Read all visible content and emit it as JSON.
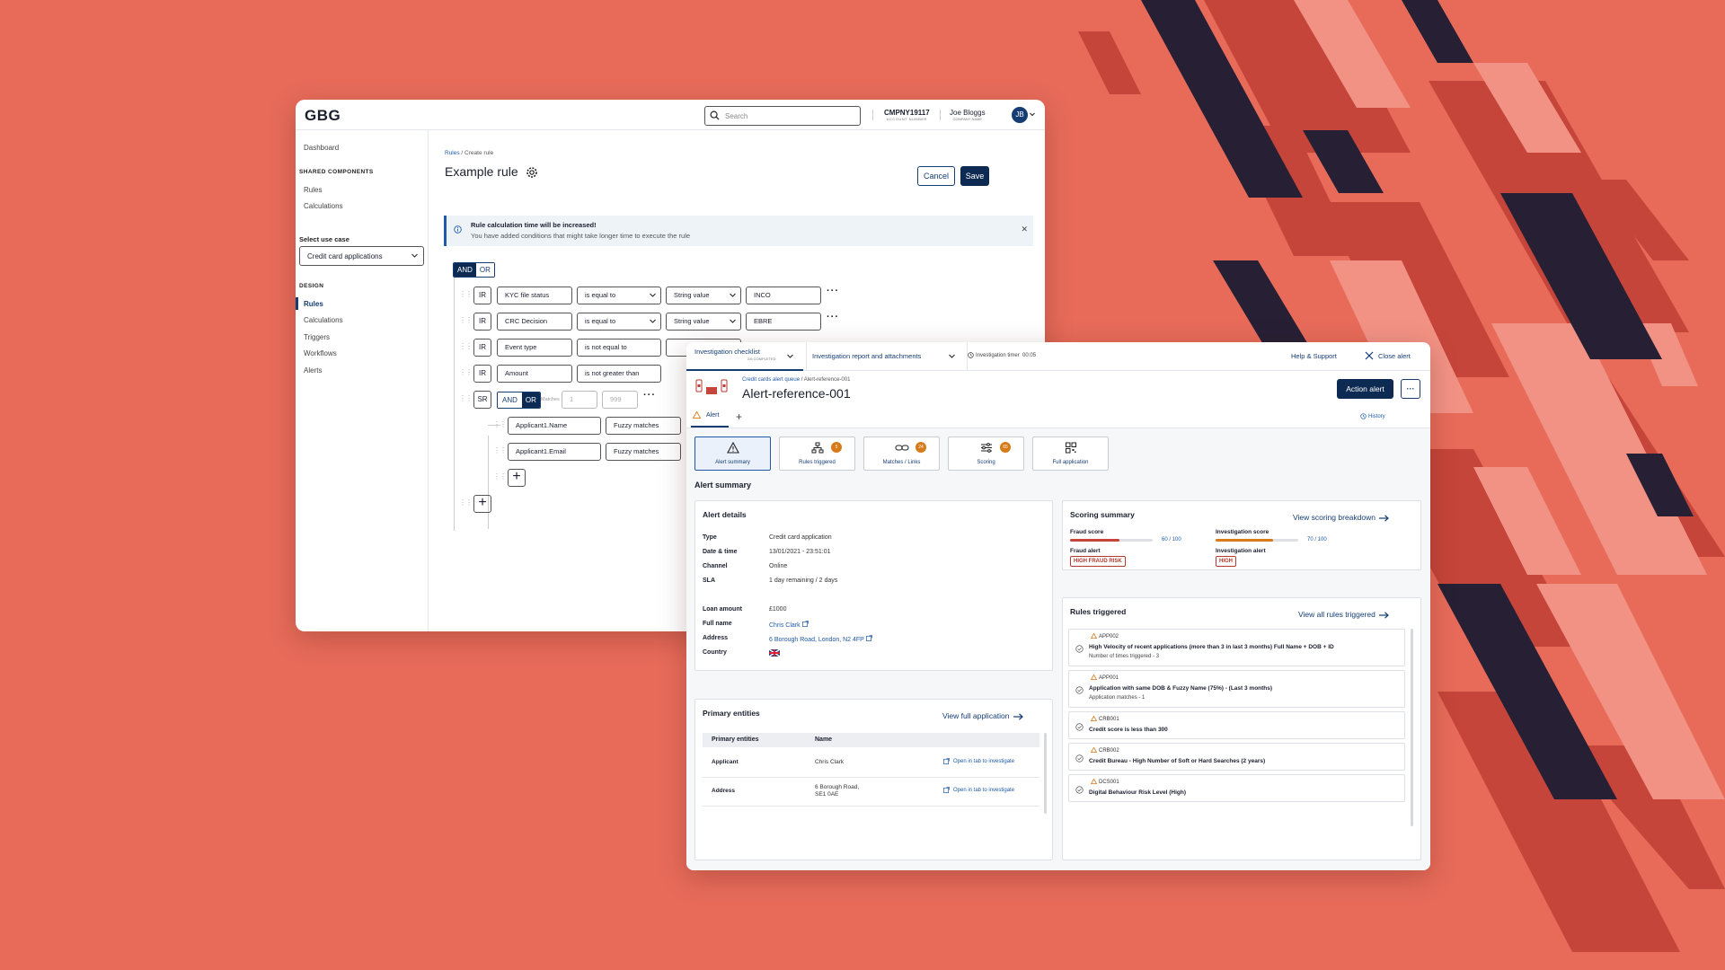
{
  "colors": {
    "background": "#E86B5A",
    "navy": "#0d2b52",
    "dark_stripe": "#272035",
    "accent_orange": "#d77a18",
    "danger": "#b33a2c"
  },
  "rules_window": {
    "logo": "GBG",
    "search_placeholder": "Search",
    "account": {
      "id": "CMPNY19117",
      "label": "ACCOUNT NUMBER"
    },
    "user": {
      "name": "Joe Bloggs",
      "label": "COMPANY NAME",
      "initials": "JB"
    },
    "sidebar": {
      "dashboard": "Dashboard",
      "shared_heading": "SHARED COMPONENTS",
      "shared_items": [
        "Rules",
        "Calculations"
      ],
      "use_case_label": "Select use case",
      "use_case_value": "Credit card applications",
      "design_heading": "DESIGN",
      "design_items": [
        "Rules",
        "Calculations",
        "Triggers",
        "Workflows",
        "Alerts"
      ],
      "active": "Rules"
    },
    "breadcrumb": {
      "parent": "Rules",
      "current": "Create rule"
    },
    "title": "Example rule",
    "cancel_label": "Cancel",
    "save_label": "Save",
    "banner": {
      "title": "Rule calculation time will be increased!",
      "text": "You have added conditions that might take longer time to execute the rule"
    },
    "logic": {
      "and": "AND",
      "or": "OR",
      "active": "AND"
    },
    "conditions": [
      {
        "tag": "IR",
        "field": "KYC file status",
        "operator": "is equal to",
        "type": "String value",
        "value": "INCO"
      },
      {
        "tag": "IR",
        "field": "CRC Decision",
        "operator": "is equal to",
        "type": "String value",
        "value": "EBRE"
      },
      {
        "tag": "IR",
        "field": "Event type",
        "operator": "is not equal to"
      },
      {
        "tag": "IR",
        "field": "Amount",
        "operator": "is not greater than"
      }
    ],
    "subrule": {
      "tag": "SR",
      "and": "AND",
      "or": "OR",
      "active": "OR",
      "matches_label": "Matches",
      "min_placeholder": "1",
      "max_placeholder": "999",
      "items": [
        {
          "field": "Applicant1.Name",
          "operator": "Fuzzy matches"
        },
        {
          "field": "Applicant1.Email",
          "operator": "Fuzzy matches"
        }
      ]
    }
  },
  "alert_window": {
    "tabs": {
      "checklist": "Investigation checklist",
      "checklist_progress": "2/6 COMPLETED",
      "report": "Investigation report and attachments"
    },
    "timer": {
      "label": "Investigation timer",
      "value": "00:05"
    },
    "help": "Help & Support",
    "close": "Close alert",
    "breadcrumb": {
      "parent": "Credit cards alert queue",
      "current": "Alert-reference-001"
    },
    "title": "Alert-reference-001",
    "action_label": "Action alert",
    "alert_tab": "Alert",
    "history": "History",
    "cards": [
      {
        "label": "Alert summary",
        "icon": "warning-icon",
        "badge": ""
      },
      {
        "label": "Rules triggered",
        "icon": "hierarchy-icon",
        "badge": "5"
      },
      {
        "label": "Matches / Links",
        "icon": "link-icon",
        "badge": "24"
      },
      {
        "label": "Scoring",
        "icon": "sliders-icon",
        "badge": "65"
      },
      {
        "label": "Full application",
        "icon": "qr-grid-icon",
        "badge": ""
      }
    ],
    "section_title": "Alert summary",
    "alert_details": {
      "title": "Alert details",
      "rows": [
        {
          "k": "Type",
          "v": "Credit card application"
        },
        {
          "k": "Date & time",
          "v": "13/01/2021 - 23:51:01"
        },
        {
          "k": "Channel",
          "v": "Online"
        },
        {
          "k": "SLA",
          "v": "1 day remaining / 2 days"
        }
      ],
      "rows2": [
        {
          "k": "Loan amount",
          "v": "£1000"
        },
        {
          "k": "Full name",
          "v": "Chris Clark"
        },
        {
          "k": "Address",
          "v": "6 Borough Road, London, N2 4FP"
        },
        {
          "k": "Country",
          "v": ""
        }
      ]
    },
    "primary": {
      "title": "Primary entities",
      "link": "View full application",
      "headers": [
        "Primary entities",
        "Name"
      ],
      "rows": [
        {
          "entity": "Applicant",
          "name": "Chris Clark",
          "name2": "",
          "action": "Open in tab to investigate"
        },
        {
          "entity": "Address",
          "name": "6 Borough Road,",
          "name2": "SE1 0AE",
          "action": "Open in tab to investigate"
        }
      ]
    },
    "scoring": {
      "title": "Scoring summary",
      "link": "View scoring breakdown",
      "fraud_label": "Fraud score",
      "fraud_value": "60 / 100",
      "fraud_pct": 60,
      "inv_label": "Investigation score",
      "inv_value": "70 / 100",
      "inv_pct": 70,
      "fraud_alert_label": "Fraud alert",
      "fraud_alert_badge": "HIGH FRAUD RISK",
      "inv_alert_label": "Investigation alert",
      "inv_alert_badge": "HIGH"
    },
    "rules": {
      "title": "Rules triggered",
      "link": "View all rules triggered",
      "items": [
        {
          "code": "APP002",
          "desc": "High Velocity of recent applications (more than 3 in last 3 months) Full Name + DOB + ID",
          "sub": "Number of times triggered - 3"
        },
        {
          "code": "APP001",
          "desc": "Application with same DOB & Fuzzy Name (75%) - (Last 3 months)",
          "sub": "Application matches - 1"
        },
        {
          "code": "CRB001",
          "desc": "Credit score is less than 300",
          "sub": ""
        },
        {
          "code": "CRB002",
          "desc": "Credit Bureau - High Number of Soft or Hard Searches (2 years)",
          "sub": ""
        },
        {
          "code": "DCS001",
          "desc": "Digital Behaviour Risk Level (High)",
          "sub": ""
        }
      ]
    }
  }
}
